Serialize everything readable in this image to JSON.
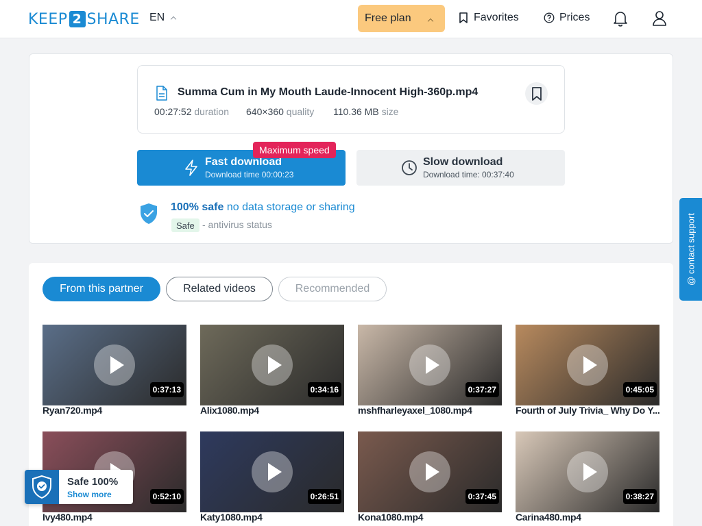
{
  "header": {
    "logo_left": "KEEP",
    "logo_mid": "2",
    "logo_right": "SHARE",
    "lang": "EN",
    "plan": "Free plan",
    "favorites": "Favorites",
    "prices": "Prices"
  },
  "file": {
    "name": "Summa Cum in My Mouth Laude-Innocent High-360p.mp4",
    "duration_value": "00:27:52",
    "duration_label": "duration",
    "quality_value": "640×360",
    "quality_label": "quality",
    "size_value": "110.36 MB",
    "size_label": "size"
  },
  "download": {
    "fast_title": "Fast download",
    "fast_sub": "Download time 00:00:23",
    "max_badge": "Maximum speed",
    "slow_title": "Slow download",
    "slow_sub": "Download time: 00:37:40"
  },
  "safety": {
    "safe_bold": "100% safe",
    "safe_rest": "no data storage or sharing",
    "tag": "Safe",
    "status": "- antivirus status"
  },
  "tabs": {
    "partner": "From this partner",
    "related": "Related videos",
    "recommended": "Recommended"
  },
  "videos": [
    {
      "title": "Ryan720.mp4",
      "duration": "0:37:13",
      "bg": "#5a6e88"
    },
    {
      "title": "Alix1080.mp4",
      "duration": "0:34:16",
      "bg": "#6e6a5a"
    },
    {
      "title": "mshfharleyaxel_1080.mp4",
      "duration": "0:37:27",
      "bg": "#c9b8a8"
    },
    {
      "title": "Fourth of July Trivia_ Why Do Y...",
      "duration": "0:45:05",
      "bg": "#b88a5e"
    },
    {
      "title": "Ivy480.mp4",
      "duration": "0:52:10",
      "bg": "#8a4e5a"
    },
    {
      "title": "Katy1080.mp4",
      "duration": "0:26:51",
      "bg": "#2e3a5e"
    },
    {
      "title": "Kona1080.mp4",
      "duration": "0:37:45",
      "bg": "#7a5a4e"
    },
    {
      "title": "Carina480.mp4",
      "duration": "0:38:27",
      "bg": "#d8c8b8"
    }
  ],
  "support": "@ contact support",
  "safe_widget": {
    "title": "Safe 100%",
    "sub": "Show more"
  },
  "colors": {
    "accent": "#1a8ad3",
    "plan": "#fbc97e",
    "badge": "#e3245a"
  }
}
